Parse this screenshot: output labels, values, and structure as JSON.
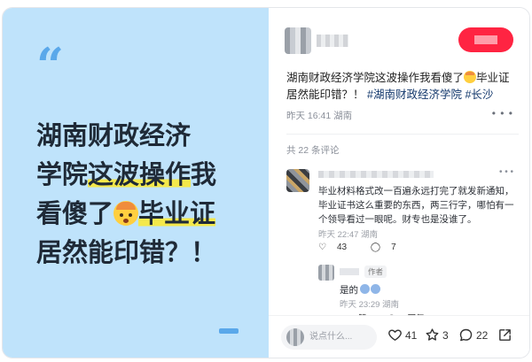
{
  "cover": {
    "quote": "“",
    "lines": [
      "湖南财政经济",
      "学院",
      "这波操作",
      "我",
      "看傻了",
      "毕业证",
      "居然能印错？！"
    ]
  },
  "post": {
    "title": "湖南财政经济学院这波操作我看傻了",
    "title_tail": "毕业证居然能印错？！",
    "tags": [
      "#湖南财政经济学院",
      "#长沙"
    ],
    "meta": "昨天 16:41 湖南",
    "comment_count": "共 22 条评论"
  },
  "comments": [
    {
      "text": "毕业材料格式改一百遍永远打完了就发新通知，毕业证书这么重要的东西，两三行字，哪怕有一个领导看过一眼呢。财专也是没谁了。",
      "meta": "昨天 22:47 湖南",
      "likes": "43",
      "replies": "7"
    }
  ],
  "reply": {
    "badge": "作者",
    "text": "是的",
    "meta": "昨天 23:29 湖南",
    "like_label": "赞",
    "reply_label": "回复"
  },
  "bottom": {
    "input_placeholder": "说点什么...",
    "likes": "41",
    "stars": "3",
    "comments": "22"
  },
  "colors": {
    "cover_bg": "#bfe3fb",
    "accent": "#5aa8ea",
    "follow": "#ff2442",
    "tag": "#13386c"
  }
}
